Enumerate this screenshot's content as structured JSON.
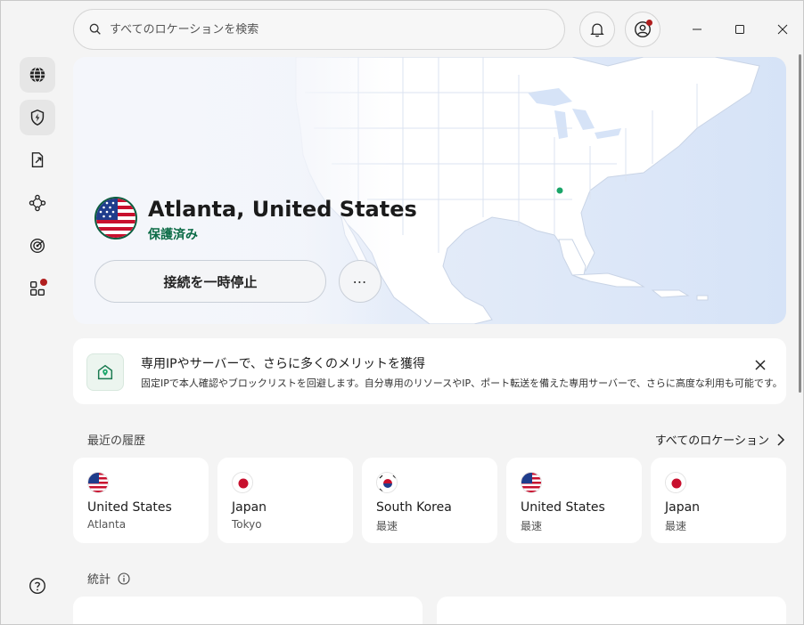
{
  "search": {
    "placeholder": "すべてのロケーションを検索"
  },
  "sidebar": {
    "items": [
      {
        "icon": "globe-icon"
      },
      {
        "icon": "shield-bolt-icon"
      },
      {
        "icon": "file-share-icon"
      },
      {
        "icon": "meshnet-icon"
      },
      {
        "icon": "radar-icon"
      },
      {
        "icon": "apps-icon"
      }
    ],
    "help_icon": "help-icon"
  },
  "header": {
    "notifications_icon": "bell-icon",
    "profile_icon": "user-icon"
  },
  "hero": {
    "location": "Atlanta, United States",
    "status": "保護済み",
    "pause_label": "接続を一時停止",
    "more_label": "⋯"
  },
  "promo": {
    "title": "専用IPやサーバーで、さらに多くのメリットを獲得",
    "description": "固定IPで本人確認やブロックリストを回避します。自分専用のリソースやIP、ポート転送を備えた専用サーバーで、さらに高度な利用も可能です。"
  },
  "recent": {
    "title": "最近の履歴",
    "all_locations": "すべてのロケーション",
    "items": [
      {
        "country": "United States",
        "city": "Atlanta",
        "flag": "us"
      },
      {
        "country": "Japan",
        "city": "Tokyo",
        "flag": "jp"
      },
      {
        "country": "South Korea",
        "city": "最速",
        "flag": "kr"
      },
      {
        "country": "United States",
        "city": "最速",
        "flag": "us"
      },
      {
        "country": "Japan",
        "city": "最速",
        "flag": "jp"
      }
    ]
  },
  "stats": {
    "title": "統計"
  },
  "colors": {
    "accent_green": "#0b6b46",
    "badge_red": "#b01e1e",
    "map_water": "#d6e3f7",
    "map_land": "#ffffff"
  }
}
